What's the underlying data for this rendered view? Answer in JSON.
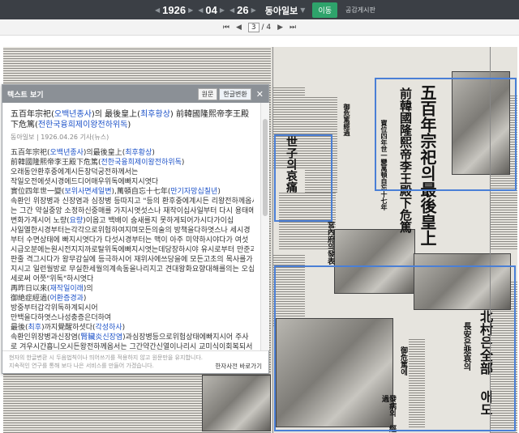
{
  "date": {
    "year": "1926",
    "month": "04",
    "day": "26"
  },
  "newspaper": "동아일보",
  "go_label": "이동",
  "board_link": "공감게시판",
  "page_indicator": {
    "current": "3",
    "separator": "/",
    "total": "4"
  },
  "viewer": {
    "title": "텍스트 보기",
    "btn_original": "원문",
    "btn_hangul": "한글변환",
    "article_title": [
      {
        "t": "五百年宗祀(",
        "c": false
      },
      {
        "t": "오백년종사",
        "c": true
      },
      {
        "t": ")의 最後皇上(",
        "c": false
      },
      {
        "t": "최후황상",
        "c": true
      },
      {
        "t": ") 前韓國隆熙帝李王殿下危篤(",
        "c": false
      },
      {
        "t": "전한국융희제이왕전하위독",
        "c": true
      },
      {
        "t": ")",
        "c": false
      }
    ],
    "meta": "동아일보 | 1926.04.26 기사(뉴스)",
    "lines": [
      [
        {
          "t": "五百年宗祀(",
          "c": false
        },
        {
          "t": "오백년종사",
          "c": true
        },
        {
          "t": ")의最後皇上(",
          "c": false
        },
        {
          "t": "최후황상",
          "c": true
        },
        {
          "t": ")",
          "c": false
        }
      ],
      [
        {
          "t": "前韓國隆熙帝李王殿下危篤(",
          "c": false
        },
        {
          "t": "전한국융희제이왕전하위독",
          "c": true
        },
        {
          "t": ")",
          "c": false
        }
      ],
      [
        {
          "t": "오래동안환후중에계시든창덕궁전하께서는",
          "c": false
        }
      ],
      [
        {
          "t": "작일오전에셧시경에드디어매우위독에빠지시엿다",
          "c": false
        }
      ],
      [
        {
          "t": "實位四年世一變(",
          "c": false
        },
        {
          "t": "보위사면세일변",
          "c": true
        },
        {
          "t": "),萬頓自忘十七年(",
          "c": false
        },
        {
          "t": "만기자망십칠년",
          "c": true
        },
        {
          "t": ")",
          "c": false
        }
      ],
      [
        {
          "t": "속환인 위장병과 신장염과 심장병 등따지고 \"등의 환후중에계시든 리왕전하께옵서",
          "c": false
        }
      ],
      [
        {
          "t": "는 그간 약실중앙 소정하신중매를 가지시엿섯스나 재작이십사일부터 다시 용태에",
          "c": false
        }
      ],
      [
        {
          "t": "변화가계시어 노량(",
          "c": false
        },
        {
          "t": "요량",
          "c": true
        },
        {
          "t": ")이옵고 백배이 숨새를지 못하게되어가시다가이십",
          "c": false
        }
      ],
      [
        {
          "t": "사일옐한시경부터는각각으로위험하여지며모든의술의 방책을다하엿스나 세시경",
          "c": false
        }
      ],
      [
        {
          "t": "부터 수면상태에 빠지시엿다가 다섯시경부터는 맥이 아주 미약하시야다가 여섯",
          "c": false
        }
      ],
      [
        {
          "t": "시급오분에는원시전지지까로탈위독에빠지시엿는데당장하시야 유시로부터 만준과",
          "c": false
        }
      ],
      [
        {
          "t": "판줄 격그시다가 왕무감실에 등극하시어 재위사에쓰당을에 모든고초의 목사를가",
          "c": false
        }
      ],
      [
        {
          "t": "지시고 일런월방로 무실한세월의계속동을나리지고 견대왕화요향대해를의는 오십살",
          "c": false
        }
      ],
      [
        {
          "t": "세로써 어쯧\"위독\"하시엿다",
          "c": false
        }
      ],
      [
        {
          "t": "再昨日以來(",
          "c": false
        },
        {
          "t": "재작일이래",
          "c": true
        },
        {
          "t": ")의",
          "c": false
        }
      ],
      [
        {
          "t": "御絶症經過(",
          "c": false
        },
        {
          "t": "어환증경과",
          "c": true
        },
        {
          "t": ")",
          "c": false
        }
      ],
      [
        {
          "t": "방중부터갑각위독하계되시어",
          "c": false
        }
      ],
      [
        {
          "t": "만백을다하엿스나성충증은더하여",
          "c": false
        }
      ],
      [
        {
          "t": "最後(",
          "c": false
        },
        {
          "t": "최후",
          "c": true
        },
        {
          "t": ")까지覺醒하셧다(",
          "c": false
        },
        {
          "t": "각성하사",
          "c": true
        },
        {
          "t": ")",
          "c": false
        }
      ],
      [
        {
          "t": "속환인위장병과신장염(",
          "c": false
        },
        {
          "t": "腎臟炎신장염",
          "c": true
        },
        {
          "t": ")과심장병등으로위험상태에빠지시어 주사",
          "c": false
        }
      ],
      [
        {
          "t": "로 겨우시간흡니오시든왕전하께옵서는 그간약간신열이나리시 교미식이회복되서",
          "c": false
        }
      ]
    ],
    "footer_note_1": "현자의 한글변환 시 두음법칙이나 띄어쓰기를 적용하지 않고 원문만을 유지합니다.",
    "footer_note_2": "지속적인 연구를 통해 보다 나은 서비스를 만들어 가겠습니다.",
    "footer_link": "한자사전 바로가기"
  },
  "headlines": {
    "main_1": "五百年宗祀의最後皇上",
    "main_2": "前韓國隆熙帝李王殿下危篤",
    "sub": "寶位四年世一變萬頓自忘十七年",
    "mid": "世子의哀痛",
    "left_col": "御危篤經過",
    "palace": "宮內府의發表",
    "bottom_1": "北村은全部 애도",
    "bottom_2": "長安은悲哀의",
    "bottom_3": "御危篤에",
    "bottom_4": "發病의 經過"
  }
}
